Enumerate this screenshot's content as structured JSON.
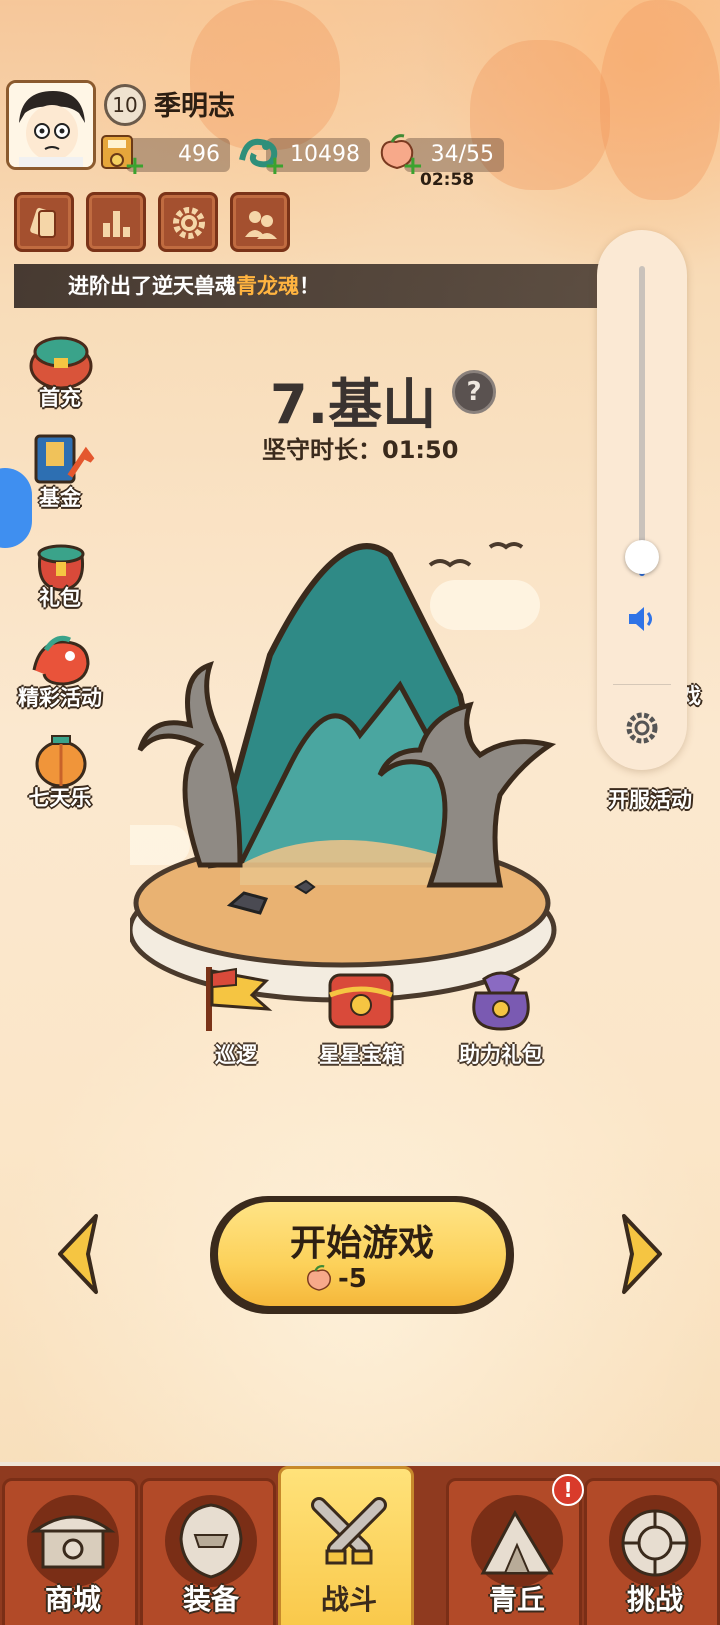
{
  "player": {
    "name": "季明志",
    "level": "10",
    "gold": "496",
    "jade": "10498",
    "stamina": "34/55",
    "stamina_timer": "02:58"
  },
  "ticker": {
    "prefix": "进阶出了逆天兽魂",
    "highlight": "青龙魂",
    "suffix": "！"
  },
  "left_menu": [
    {
      "label": "首充",
      "icon": "first-recharge-icon"
    },
    {
      "label": "基金",
      "icon": "fund-icon"
    },
    {
      "label": "礼包",
      "icon": "gift-bag-icon"
    },
    {
      "label": "精彩活动",
      "icon": "events-icon"
    },
    {
      "label": "七天乐",
      "icon": "seven-day-icon"
    }
  ],
  "right_menu": [
    {
      "label": "开服活动"
    },
    {
      "label": "戏"
    }
  ],
  "stage": {
    "title": "7.基山",
    "help": "?",
    "hold_label": "坚守时长：01:50"
  },
  "stage_actions": [
    {
      "label": "巡逻",
      "icon": "patrol-flag-icon"
    },
    {
      "label": "星星宝箱",
      "icon": "star-chest-icon"
    },
    {
      "label": "助力礼包",
      "icon": "assist-bag-icon"
    }
  ],
  "start": {
    "label": "开始游戏",
    "cost": "-5"
  },
  "volume": {
    "level": 0.06
  },
  "nav": [
    {
      "label": "商城",
      "icon": "shop-icon"
    },
    {
      "label": "装备",
      "icon": "armor-icon"
    },
    {
      "label": "战斗",
      "icon": "crossed-swords-icon",
      "active": true
    },
    {
      "label": "青丘",
      "icon": "mountain-icon"
    },
    {
      "label": "挑战",
      "icon": "challenge-icon"
    }
  ],
  "nav_badge": "!",
  "colors": {
    "accent_yellow": "#f9c94b",
    "nav_red": "#b24a28",
    "volume_blue": "#2f73e6",
    "ticker_highlight": "#ffb440"
  }
}
